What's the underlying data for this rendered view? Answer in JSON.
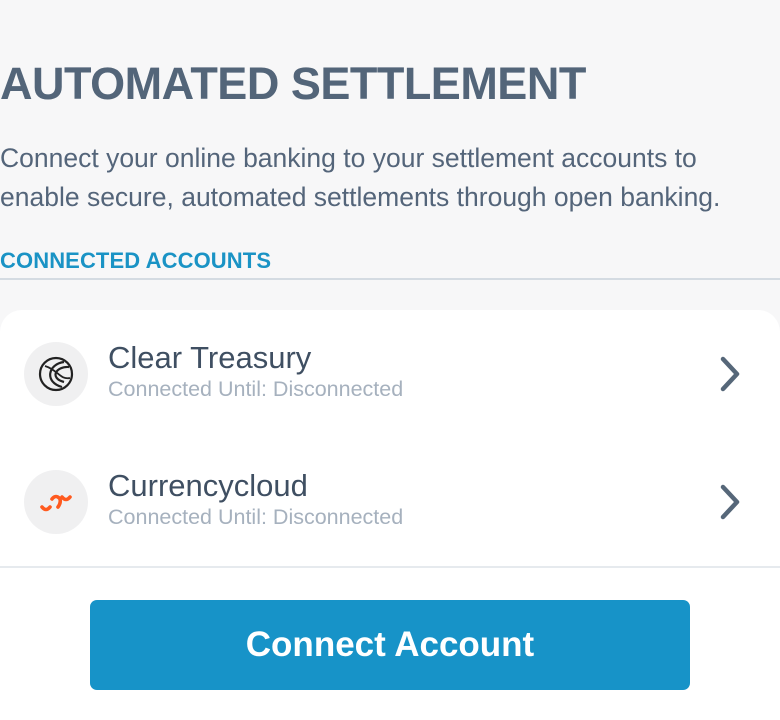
{
  "header": {
    "title": "AUTOMATED SETTLEMENT",
    "description": "Connect your online banking to your settlement accounts to enable secure, automated settlements through open banking."
  },
  "section": {
    "label": "CONNECTED ACCOUNTS"
  },
  "accounts": [
    {
      "name": "Clear Treasury",
      "status": "Connected Until: Disconnected",
      "logo_icon": "clear-treasury-logo-icon"
    },
    {
      "name": "Currencycloud",
      "status": "Connected Until: Disconnected",
      "logo_icon": "currencycloud-logo-icon"
    }
  ],
  "actions": {
    "connect_label": "Connect Account"
  },
  "colors": {
    "title": "#536579",
    "accent": "#1a93c5",
    "button": "#1793c8",
    "currencycloud_brand": "#ff5a1f",
    "muted_text": "#a6b1be"
  }
}
